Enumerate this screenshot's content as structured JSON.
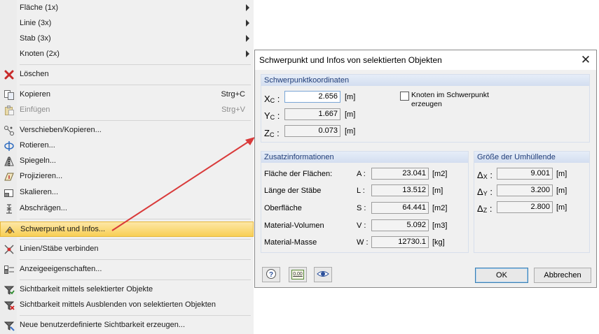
{
  "menu": {
    "items": [
      {
        "label": "Fläche (1x)",
        "submenu": true
      },
      {
        "label": "Linie (3x)",
        "submenu": true
      },
      {
        "label": "Stab (3x)",
        "submenu": true
      },
      {
        "label": "Knoten (2x)",
        "submenu": true
      },
      {
        "label": "Löschen",
        "icon": "delete-x-icon"
      },
      {
        "label": "Kopieren",
        "shortcut": "Strg+C",
        "icon": "copy-icon"
      },
      {
        "label": "Einfügen",
        "shortcut": "Strg+V",
        "icon": "paste-icon",
        "disabled": true
      },
      {
        "label": "Verschieben/Kopieren...",
        "icon": "move-copy-icon"
      },
      {
        "label": "Rotieren...",
        "icon": "rotate-icon"
      },
      {
        "label": "Spiegeln...",
        "icon": "mirror-icon"
      },
      {
        "label": "Projizieren...",
        "icon": "project-icon"
      },
      {
        "label": "Skalieren...",
        "icon": "scale-icon"
      },
      {
        "label": "Abschrägen...",
        "icon": "shear-icon"
      },
      {
        "label": "Schwerpunkt und Infos...",
        "icon": "centroid-icon",
        "highlighted": true
      },
      {
        "label": "Linien/Stäbe verbinden",
        "icon": "connect-lines-icon"
      },
      {
        "label": "Anzeigeeigenschaften...",
        "icon": "display-properties-icon"
      },
      {
        "label": "Sichtbarkeit mittels selektierter Objekte",
        "icon": "visibility-selected-icon"
      },
      {
        "label": "Sichtbarkeit mittels Ausblenden von selektierten Objekten",
        "icon": "visibility-hide-icon"
      },
      {
        "label": "Neue benutzerdefinierte Sichtbarkeit erzeugen...",
        "icon": "new-visibility-icon"
      }
    ]
  },
  "dialog": {
    "title": "Schwerpunkt und Infos von selektierten Objekten",
    "centroid": {
      "header": "Schwerpunktkoordinaten",
      "rows": [
        {
          "symbol": "X",
          "sub": "C",
          "value": "2.656",
          "unit": "[m]"
        },
        {
          "symbol": "Y",
          "sub": "C",
          "value": "1.667",
          "unit": "[m]"
        },
        {
          "symbol": "Z",
          "sub": "C",
          "value": "0.073",
          "unit": "[m]"
        }
      ],
      "colon": ":",
      "checkbox_label_line1": "Knoten im Schwerpunkt",
      "checkbox_label_line2": "erzeugen"
    },
    "info": {
      "header": "Zusatzinformationen",
      "rows": [
        {
          "label": "Fläche der Flächen:",
          "symbol": "A :",
          "value": "23.041",
          "unit": "[m2]"
        },
        {
          "label": "Länge der Stäbe",
          "symbol": "L :",
          "value": "13.512",
          "unit": "[m]"
        },
        {
          "label": "Oberfläche",
          "symbol": "S :",
          "value": "64.441",
          "unit": "[m2]"
        },
        {
          "label": "Material-Volumen",
          "symbol": "V :",
          "value": "5.092",
          "unit": "[m3]"
        },
        {
          "label": "Material-Masse",
          "symbol": "W :",
          "value": "12730.1",
          "unit": "[kg]"
        }
      ]
    },
    "envelope": {
      "header": "Größe der Umhüllende",
      "rows": [
        {
          "symbol": "Δ",
          "sub": "X",
          "value": "9.001",
          "unit": "[m]"
        },
        {
          "symbol": "Δ",
          "sub": "Y",
          "value": "3.200",
          "unit": "[m]"
        },
        {
          "symbol": "Δ",
          "sub": "Z",
          "value": "2.800",
          "unit": "[m]"
        }
      ]
    },
    "ok_label": "OK",
    "cancel_label": "Abbrechen",
    "decimal_icon_text": "0.00"
  }
}
